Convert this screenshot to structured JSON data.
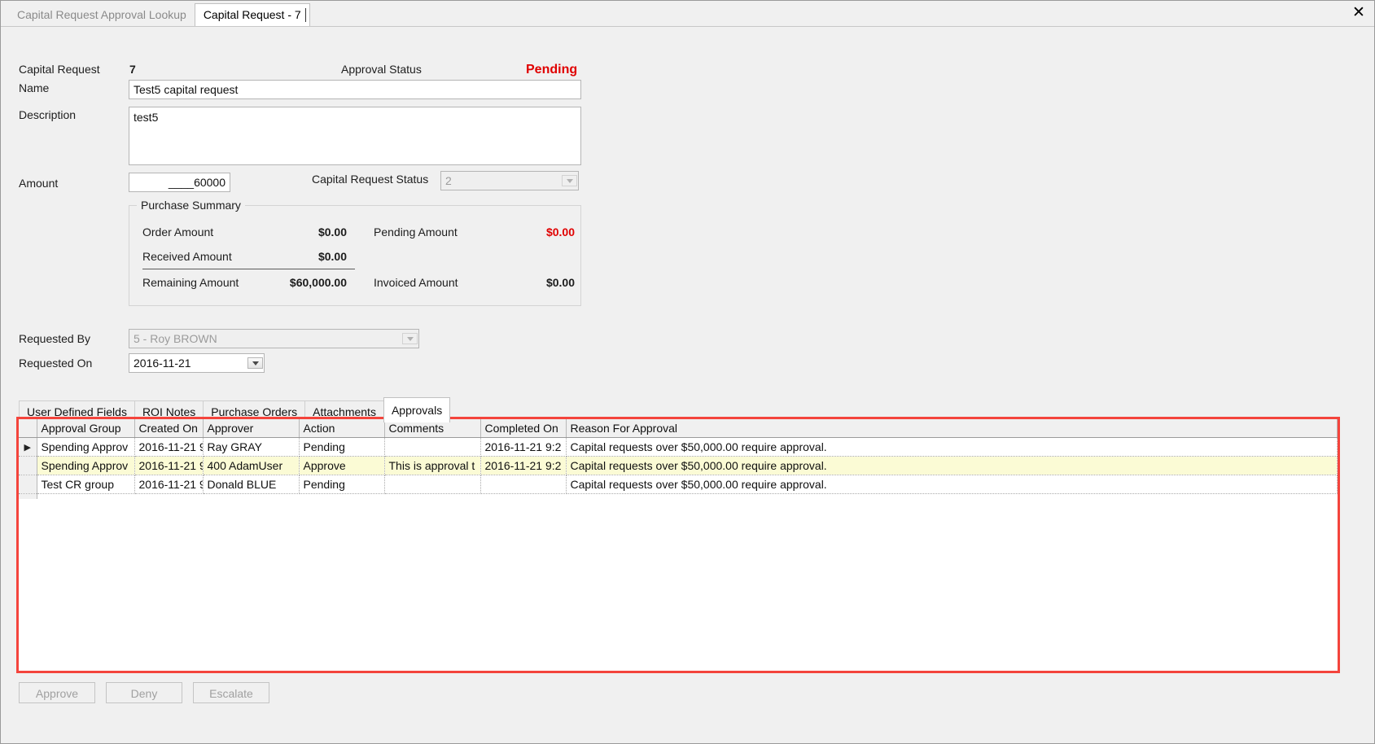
{
  "window": {
    "close_label": "✕",
    "tabs": [
      {
        "label": "Capital Request Approval Lookup",
        "active": false
      },
      {
        "label": "Capital Request - 7",
        "active": true
      }
    ]
  },
  "header": {
    "capital_request_label": "Capital Request",
    "capital_request_id": "7",
    "approval_status_label": "Approval Status",
    "approval_status_value": "Pending",
    "approval_status_color": "#e00000"
  },
  "form": {
    "name_label": "Name",
    "name_value": "Test5 capital request",
    "description_label": "Description",
    "description_value": "test5",
    "amount_label": "Amount",
    "amount_value": "____60000",
    "capital_request_status_label": "Capital Request Status",
    "capital_request_status_value": "2",
    "requested_by_label": "Requested By",
    "requested_by_value": "5 - Roy BROWN",
    "requested_on_label": "Requested On",
    "requested_on_value": "2016-11-21"
  },
  "purchase_summary": {
    "title": "Purchase Summary",
    "order_amount_label": "Order Amount",
    "order_amount_value": "$0.00",
    "received_amount_label": "Received Amount",
    "received_amount_value": "$0.00",
    "remaining_amount_label": "Remaining Amount",
    "remaining_amount_value": "$60,000.00",
    "pending_amount_label": "Pending Amount",
    "pending_amount_value": "$0.00",
    "pending_amount_color": "#e00000",
    "invoiced_amount_label": "Invoiced Amount",
    "invoiced_amount_value": "$0.00"
  },
  "detail_tabs": [
    {
      "label": "User Defined Fields",
      "active": false
    },
    {
      "label": "ROI Notes",
      "active": false
    },
    {
      "label": "Purchase Orders",
      "active": false
    },
    {
      "label": "Attachments",
      "active": false
    },
    {
      "label": "Approvals",
      "active": true
    }
  ],
  "approvals_grid": {
    "columns": [
      "Approval Group",
      "Created On",
      "Approver",
      "Action",
      "Comments",
      "Completed On",
      "Reason For Approval"
    ],
    "rows": [
      {
        "indicator": "▶",
        "selected": false,
        "approval_group": "Spending Approv",
        "created_on": "2016-11-21 9",
        "approver": "Ray GRAY",
        "action": "Pending",
        "comments": "",
        "completed_on": "2016-11-21 9:2",
        "reason_for_approval": "Capital requests over $50,000.00 require approval."
      },
      {
        "indicator": "",
        "selected": true,
        "approval_group": "Spending Approv",
        "created_on": "2016-11-21 9",
        "approver": "400 AdamUser",
        "action": "Approve",
        "comments": "This is approval t",
        "completed_on": "2016-11-21 9:2",
        "reason_for_approval": "Capital requests over $50,000.00 require approval."
      },
      {
        "indicator": "",
        "selected": false,
        "approval_group": "Test CR group",
        "created_on": "2016-11-21 9",
        "approver": "Donald BLUE",
        "action": "Pending",
        "comments": "",
        "completed_on": "",
        "reason_for_approval": "Capital requests over $50,000.00 require approval."
      }
    ],
    "highlight_color": "#f4443c"
  },
  "actions": {
    "approve_label": "Approve",
    "deny_label": "Deny",
    "escalate_label": "Escalate"
  }
}
